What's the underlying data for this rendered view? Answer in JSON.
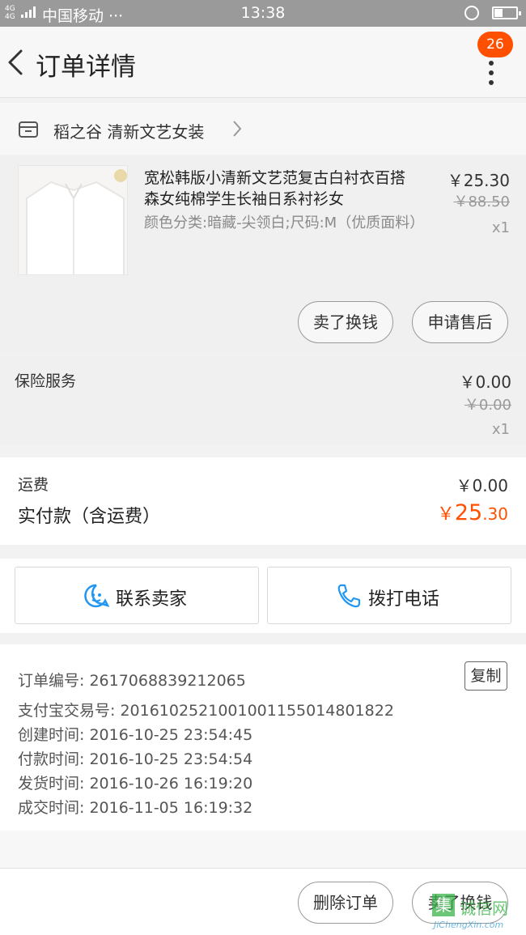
{
  "status_bar": {
    "network": "4G 4G",
    "carrier": "中国移动 ···",
    "time": "13:38"
  },
  "header": {
    "title": "订单详情",
    "badge_count": "26"
  },
  "shop": {
    "name": "稻之谷 清新文艺女装"
  },
  "item": {
    "title": "宽松韩版小清新文艺范复古白衬衣百搭森女纯棉学生长袖日系衬衫女",
    "sku": "颜色分类:暗藏-尖领白;尺码:M（优质面料）",
    "price": "￥25.30",
    "original_price": "￥88.50",
    "quantity": "x1",
    "buttons": [
      "卖了换钱",
      "申请售后"
    ]
  },
  "insurance": {
    "label": "保险服务",
    "price": "￥0.00",
    "original_price": "￥0.00",
    "quantity": "x1"
  },
  "summary": {
    "shipping_label": "运费",
    "shipping_value": "￥0.00",
    "paid_label": "实付款（含运费）",
    "paid_currency": "￥",
    "paid_int": "25",
    "paid_dec": ".30"
  },
  "actions": {
    "contact_seller": "联系卖家",
    "call_phone": "拨打电话"
  },
  "order_info": {
    "order_no": "订单编号: 2617068839212065",
    "copy_label": "复制",
    "alipay_no": "支付宝交易号: 2016102521001001155014801822",
    "created": "创建时间: 2016-10-25 23:54:45",
    "paid": "付款时间: 2016-10-25 23:54:54",
    "shipped": "发货时间: 2016-10-26 16:19:20",
    "completed": "成交时间: 2016-11-05 16:19:32"
  },
  "bottom_bar": {
    "delete_order": "删除订单",
    "resell": "卖了换钱"
  },
  "watermark": {
    "char": "集",
    "cn": "诚信网",
    "en": "JiChengXin.com"
  },
  "colors": {
    "accent": "#ff5000",
    "icon_blue": "#2196f3",
    "statusbar": "#9a9a9a"
  }
}
